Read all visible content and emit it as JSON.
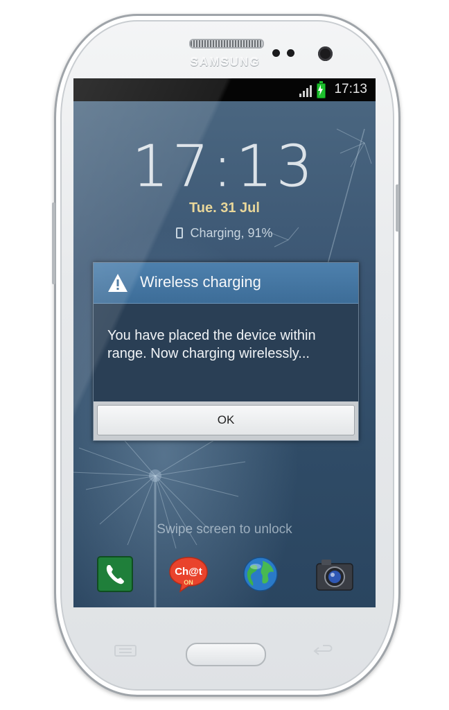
{
  "device": {
    "brand": "SAMSUNG"
  },
  "statusbar": {
    "time": "17:13"
  },
  "lockscreen": {
    "clock": "17:13",
    "date": "Tue. 31 Jul",
    "charging_status": "Charging, 91%",
    "swipe_hint": "Swipe screen to unlock"
  },
  "dialog": {
    "title": "Wireless charging",
    "message": "You have placed the device within range. Now charging wirelessly...",
    "ok_label": "OK",
    "icon": "warning-icon"
  },
  "dock": {
    "items": [
      {
        "icon": "phone-icon"
      },
      {
        "icon": "chaton-icon",
        "label": "Ch@t",
        "sublabel": "ON"
      },
      {
        "icon": "internet-globe-icon"
      },
      {
        "icon": "camera-icon"
      }
    ]
  },
  "hardware_keys": [
    "menu-key",
    "home-key",
    "back-key"
  ],
  "colors": {
    "dialog_header": "#4d80ad",
    "date_text": "#e9d79a",
    "battery": "#1dbf2d"
  }
}
